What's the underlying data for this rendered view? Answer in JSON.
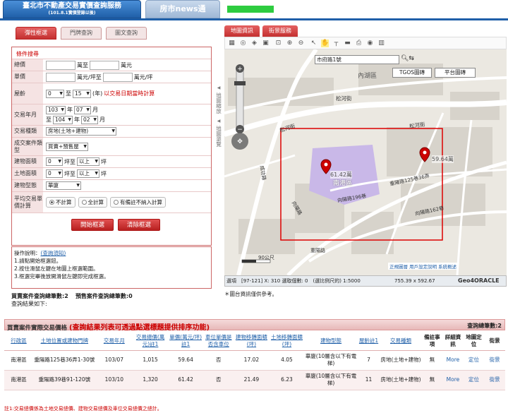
{
  "header": {
    "tab1_title": "臺北市不動產交易實價查詢服務",
    "tab1_sub": "(101.8.1實價登錄以後)",
    "tab2": "房市news通"
  },
  "query": {
    "tabs": [
      "彈性框選",
      "門牌查詢",
      "圖文查詢"
    ],
    "condition_title": "條件搜尋",
    "total_price": {
      "label": "總價",
      "to": "萬至",
      "unit": "萬元"
    },
    "unit_price": {
      "label": "單價",
      "to": "萬元/坪至",
      "unit": "萬元/坪"
    },
    "age": {
      "label": "屋齡",
      "from": "0",
      "to_word": "至",
      "to": "15",
      "unit": "(年)",
      "note": "以交易日期當時計算"
    },
    "date": {
      "label": "交易年月",
      "y1": "103",
      "y_word": "年",
      "m1": "07",
      "m_word": "月",
      "to_word": "至",
      "y2": "104",
      "m2": "02"
    },
    "type": {
      "label": "交易種類",
      "value": "房地(土地+建物)"
    },
    "case_type": {
      "label": "成交案件類型",
      "value": "買賣+預售屋"
    },
    "bld_area": {
      "label": "建物面積",
      "value": "0",
      "unit": "坪至",
      "op": "以上",
      "unit2": "坪"
    },
    "land_area": {
      "label": "土地面積",
      "value": "0",
      "unit": "坪至",
      "op": "以上",
      "unit2": "坪"
    },
    "form": {
      "label": "建物型態",
      "value": "華廈"
    },
    "avg": {
      "label": "平均交易單價計算",
      "opt1": "不計算",
      "opt2": "全計算",
      "opt3": "有備註不納入計算"
    },
    "start_btn": "開始框選",
    "clear_btn": "清除框選"
  },
  "help": {
    "title": "操作說明：",
    "link": "(查詢須知)",
    "l1": "1.請點開始框選鈕。",
    "l2": "2.按住滑鼠左鍵在地圖上框選範圍。",
    "l3": "3.框選完畢後放開滑鼠左鍵即完成框選。"
  },
  "counts": {
    "sale": "買賣案件查詢總筆數:2",
    "presale": "預售案件查詢總筆數:0",
    "result": "查詢結果如下:"
  },
  "map": {
    "tabs": [
      "地圖資訊",
      "街景服務"
    ],
    "search_value": "市府路1號",
    "btn_tgos": "TGOS圖磚",
    "btn_flat": "平台圖磚",
    "side1": "地圖縮放",
    "side2": "地圖瀏覽",
    "labels": {
      "neihu": "內湖區",
      "songhe1": "松河街",
      "songhe2": "松河街",
      "songhe3": "松河街",
      "nangang": "南港區",
      "xiangyang": "向陽路",
      "xiangyang196": "向陽路196巷",
      "chongyang": "重陽路",
      "chongyang125": "重陽路125巷36弄",
      "xiangyang162": "向陽路162巷",
      "chenggong": "成功路",
      "scale": "90公尺"
    },
    "pin1": "61.42萬",
    "pin2": "59.64萬",
    "status": "選項　[97-121] X: 310 選取個數: 0　(選比例尺的) 1:5000",
    "coords": "755.39 x 592.67",
    "brand": "Geo4ORACLE",
    "links": "正規圖層  用戶設定說明  系統概述",
    "note": "＊圖台資訊僅供參考。"
  },
  "results": {
    "title": "買賣案件實際交易價格",
    "title_em": "(查詢結果列表可透過點選標題提供排序功能)",
    "count": "查詢總筆數:2",
    "columns": [
      "行政區",
      "土地位置或建物門牌",
      "交易年月",
      "交易總價(萬元)註1",
      "單價(萬元/坪)註1",
      "車位單價是否含車位",
      "建物移轉面積(坪)",
      "土地移轉面積(坪)",
      "建物型態",
      "屋齡註1",
      "交易種類",
      "備註事項",
      "詳細資訊",
      "地圖定位",
      "街景"
    ],
    "rows": [
      {
        "district": "南港區",
        "addr": "重陽路125巷36弄1-30號",
        "ym": "103/07",
        "total": "1,015",
        "unit": "59.64",
        "park": "否",
        "barea": "17.02",
        "larea": "4.05",
        "form": "華廈(10層含以下有電梯)",
        "age": "7",
        "kind": "房地(土地+建物)",
        "memo": "無",
        "more": "More",
        "loc": "定位",
        "sv": "街景"
      },
      {
        "district": "南港區",
        "addr": "重陽路39巷91-120號",
        "ym": "103/10",
        "total": "1,320",
        "unit": "61.42",
        "park": "否",
        "barea": "21.49",
        "larea": "6.23",
        "form": "華廈(10層含以下有電梯)",
        "age": "11",
        "kind": "房地(土地+建物)",
        "memo": "無",
        "more": "More",
        "loc": "定位",
        "sv": "街景"
      }
    ],
    "footnote": "註1:交易總價係為土地交易總價、建物交易總價及車位交易總價之總計。"
  }
}
